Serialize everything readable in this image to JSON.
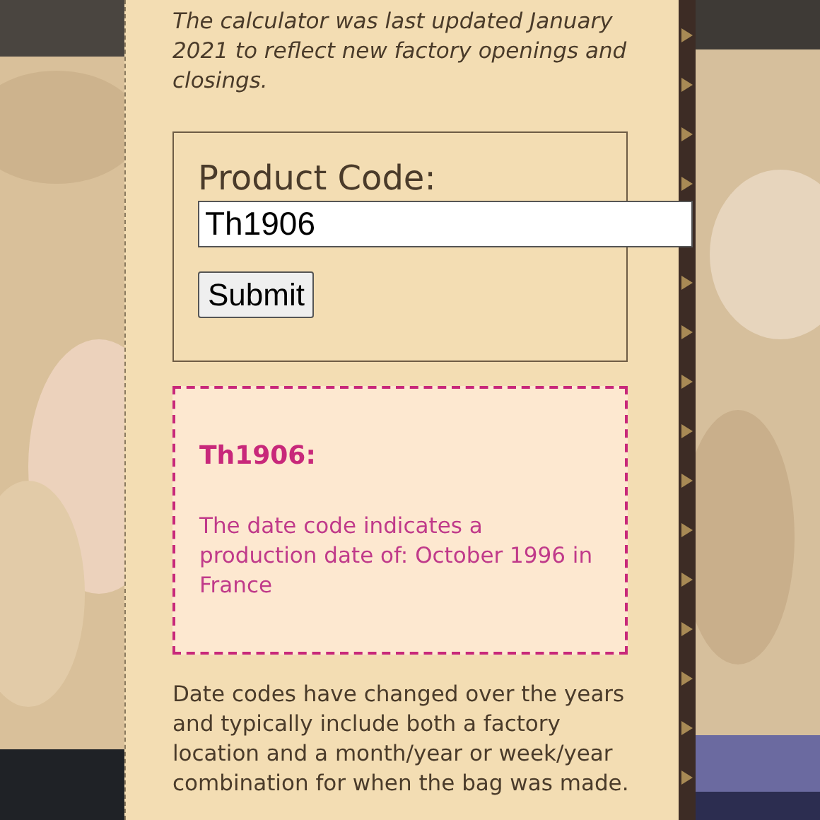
{
  "note": "The calculator was last updated January 2021 to reflect new factory openings and closings.",
  "form": {
    "label": "Product Code:",
    "value": "Th1906",
    "button": "Submit"
  },
  "result": {
    "title": "Th1906:",
    "text": "The date code indicates a production date of: October 1996 in France"
  },
  "description": "Date codes have changed over the years and typically include both a factory location and a month/year or week/year combination for when the bag was made."
}
